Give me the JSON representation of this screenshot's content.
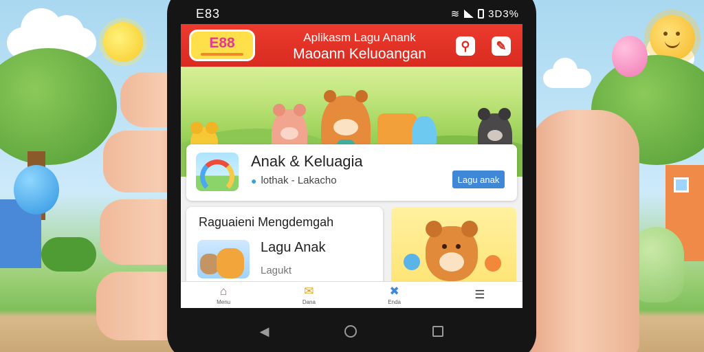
{
  "status_bar": {
    "left": "E83",
    "right": "3D3%"
  },
  "header": {
    "logo_text": "E88",
    "title_line1": "Aplikasm Lagu Anank",
    "title_line2": "Maoann Keluoangan",
    "search_icon": "search-icon",
    "edit_icon": "edit-icon",
    "accent_color": "#d92b20"
  },
  "featured_card": {
    "title": "Anak & Keluagia",
    "meta_icon": "pin-icon",
    "meta": "lothak - Lakacho",
    "button_label": "Lagu anak",
    "button_color": "#3f88d8"
  },
  "section_card": {
    "heading": "Raguaieni Mengdemgah",
    "item_title": "Lagu Anak",
    "item_sub": "Lagukt"
  },
  "bottom_nav": [
    {
      "icon": "home-icon",
      "label": "Menu"
    },
    {
      "icon": "mail-icon",
      "label": "Dana"
    },
    {
      "icon": "tools-icon",
      "label": "Enda"
    },
    {
      "icon": "list-icon",
      "label": ""
    }
  ]
}
